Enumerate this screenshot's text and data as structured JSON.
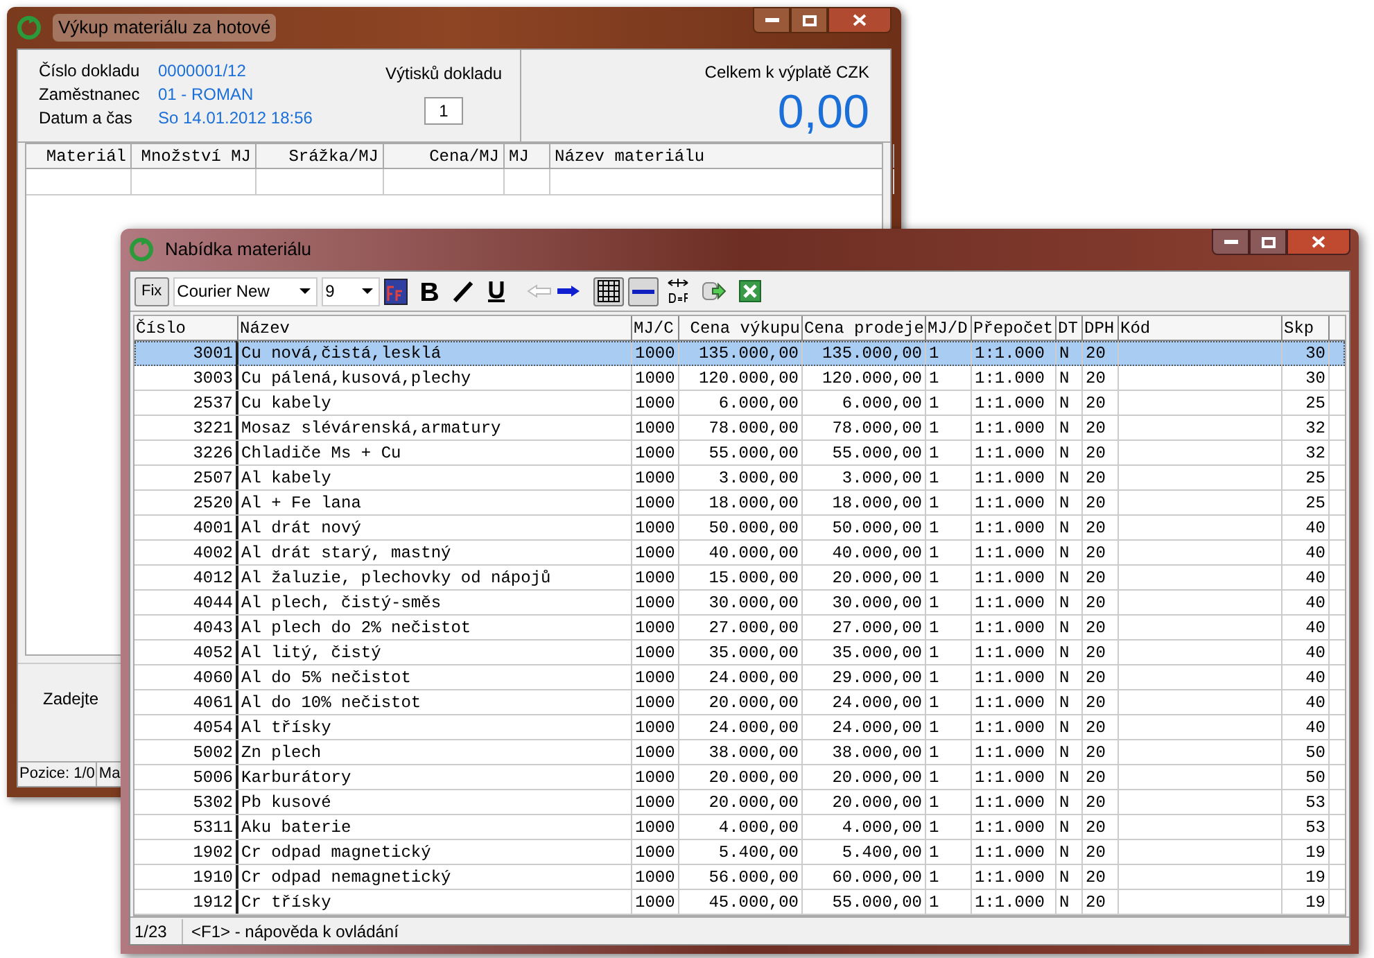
{
  "back_window": {
    "title": "Výkup materiálu za hotové",
    "fields": [
      {
        "label": "Číslo dokladu",
        "value": "0000001/12"
      },
      {
        "label": "Zaměstnanec",
        "value": "01 - ROMAN"
      },
      {
        "label": "Datum a čas",
        "value": "So 14.01.2012 18:56"
      }
    ],
    "copies": {
      "label": "Výtisků dokladu",
      "value": "1"
    },
    "total": {
      "label": "Celkem k výplatě CZK",
      "value": "0,00"
    },
    "columns": [
      "Materiál",
      "Množství MJ",
      "Srážka/MJ",
      "Cena/MJ",
      "MJ",
      "Název materiálu"
    ],
    "prompt": "Zadejte",
    "status_bar": [
      "Pozice: 1/0",
      "Ma"
    ]
  },
  "front_window": {
    "title": "Nabídka materiálu",
    "toolbar": {
      "fix": "Fix",
      "font": "Courier New",
      "size": "9"
    },
    "columns": [
      "Číslo",
      "Název",
      "MJ/C",
      "Cena výkupu",
      "Cena prodeje",
      "MJ/D",
      "Přepočet",
      "DT",
      "DPH",
      "Kód",
      "Skp"
    ],
    "rows": [
      {
        "selected": true,
        "cells": [
          "3001",
          "Cu nová,čistá,lesklá",
          "1000",
          "135.000,00",
          "135.000,00",
          "1",
          "1:1.000",
          "N",
          "20",
          "",
          "30"
        ]
      },
      {
        "selected": false,
        "cells": [
          "3003",
          "Cu pálená,kusová,plechy",
          "1000",
          "120.000,00",
          "120.000,00",
          "1",
          "1:1.000",
          "N",
          "20",
          "",
          "30"
        ]
      },
      {
        "selected": false,
        "cells": [
          "2537",
          "Cu kabely",
          "1000",
          "6.000,00",
          "6.000,00",
          "1",
          "1:1.000",
          "N",
          "20",
          "",
          "25"
        ]
      },
      {
        "selected": false,
        "cells": [
          "3221",
          "Mosaz slévárenská,armatury",
          "1000",
          "78.000,00",
          "78.000,00",
          "1",
          "1:1.000",
          "N",
          "20",
          "",
          "32"
        ]
      },
      {
        "selected": false,
        "cells": [
          "3226",
          "Chladiče Ms + Cu",
          "1000",
          "55.000,00",
          "55.000,00",
          "1",
          "1:1.000",
          "N",
          "20",
          "",
          "32"
        ]
      },
      {
        "selected": false,
        "cells": [
          "2507",
          "Al kabely",
          "1000",
          "3.000,00",
          "3.000,00",
          "1",
          "1:1.000",
          "N",
          "20",
          "",
          "25"
        ]
      },
      {
        "selected": false,
        "cells": [
          "2520",
          "Al + Fe lana",
          "1000",
          "18.000,00",
          "18.000,00",
          "1",
          "1:1.000",
          "N",
          "20",
          "",
          "25"
        ]
      },
      {
        "selected": false,
        "cells": [
          "4001",
          "Al drát nový",
          "1000",
          "50.000,00",
          "50.000,00",
          "1",
          "1:1.000",
          "N",
          "20",
          "",
          "40"
        ]
      },
      {
        "selected": false,
        "cells": [
          "4002",
          "Al drát starý, mastný",
          "1000",
          "40.000,00",
          "40.000,00",
          "1",
          "1:1.000",
          "N",
          "20",
          "",
          "40"
        ]
      },
      {
        "selected": false,
        "cells": [
          "4012",
          "Al žaluzie, plechovky od nápojů",
          "1000",
          "15.000,00",
          "20.000,00",
          "1",
          "1:1.000",
          "N",
          "20",
          "",
          "40"
        ]
      },
      {
        "selected": false,
        "cells": [
          "4044",
          "Al plech, čistý-směs",
          "1000",
          "30.000,00",
          "30.000,00",
          "1",
          "1:1.000",
          "N",
          "20",
          "",
          "40"
        ]
      },
      {
        "selected": false,
        "cells": [
          "4043",
          "Al plech do 2% nečistot",
          "1000",
          "27.000,00",
          "27.000,00",
          "1",
          "1:1.000",
          "N",
          "20",
          "",
          "40"
        ]
      },
      {
        "selected": false,
        "cells": [
          "4052",
          "Al litý, čistý",
          "1000",
          "35.000,00",
          "35.000,00",
          "1",
          "1:1.000",
          "N",
          "20",
          "",
          "40"
        ]
      },
      {
        "selected": false,
        "cells": [
          "4060",
          "Al do 5% nečistot",
          "1000",
          "24.000,00",
          "29.000,00",
          "1",
          "1:1.000",
          "N",
          "20",
          "",
          "40"
        ]
      },
      {
        "selected": false,
        "cells": [
          "4061",
          "Al do 10% nečistot",
          "1000",
          "20.000,00",
          "24.000,00",
          "1",
          "1:1.000",
          "N",
          "20",
          "",
          "40"
        ]
      },
      {
        "selected": false,
        "cells": [
          "4054",
          "Al třísky",
          "1000",
          "24.000,00",
          "24.000,00",
          "1",
          "1:1.000",
          "N",
          "20",
          "",
          "40"
        ]
      },
      {
        "selected": false,
        "cells": [
          "5002",
          "Zn plech",
          "1000",
          "38.000,00",
          "38.000,00",
          "1",
          "1:1.000",
          "N",
          "20",
          "",
          "50"
        ]
      },
      {
        "selected": false,
        "cells": [
          "5006",
          "Karburátory",
          "1000",
          "20.000,00",
          "20.000,00",
          "1",
          "1:1.000",
          "N",
          "20",
          "",
          "50"
        ]
      },
      {
        "selected": false,
        "cells": [
          "5302",
          "Pb kusové",
          "1000",
          "20.000,00",
          "20.000,00",
          "1",
          "1:1.000",
          "N",
          "20",
          "",
          "53"
        ]
      },
      {
        "selected": false,
        "cells": [
          "5311",
          "Aku baterie",
          "1000",
          "4.000,00",
          "4.000,00",
          "1",
          "1:1.000",
          "N",
          "20",
          "",
          "53"
        ]
      },
      {
        "selected": false,
        "cells": [
          "1902",
          "Cr odpad magnetický",
          "1000",
          "5.400,00",
          "5.400,00",
          "1",
          "1:1.000",
          "N",
          "20",
          "",
          "19"
        ]
      },
      {
        "selected": false,
        "cells": [
          "1910",
          "Cr odpad nemagnetický",
          "1000",
          "56.000,00",
          "60.000,00",
          "1",
          "1:1.000",
          "N",
          "20",
          "",
          "19"
        ]
      },
      {
        "selected": false,
        "cells": [
          "1912",
          "Cr třísky",
          "1000",
          "45.000,00",
          "55.000,00",
          "1",
          "1:1.000",
          "N",
          "20",
          "",
          "19"
        ]
      }
    ],
    "status_bar": [
      "1/23",
      "<F1> - nápověda k ovládání"
    ]
  }
}
